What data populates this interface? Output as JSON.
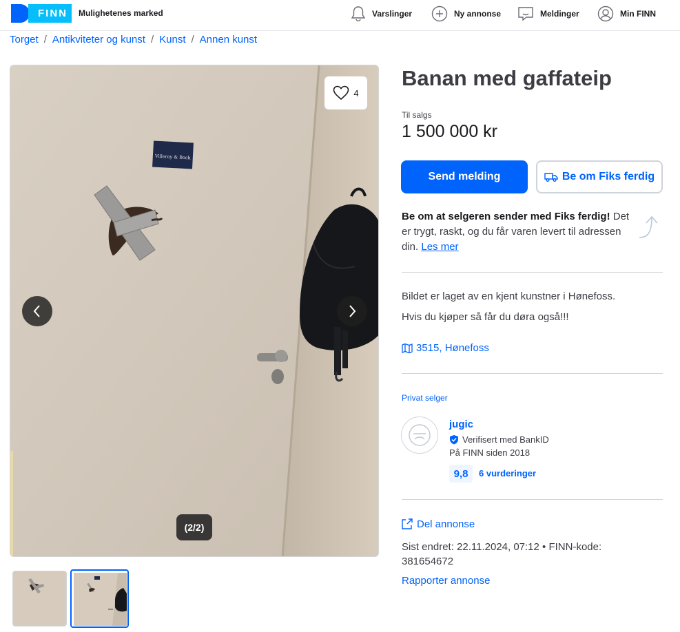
{
  "header": {
    "logo_text": "FINN",
    "slogan": "Mulighetenes marked",
    "nav": [
      {
        "label": "Varslinger",
        "icon": "bell-icon"
      },
      {
        "label": "Ny annonse",
        "icon": "plus-circle-icon"
      },
      {
        "label": "Meldinger",
        "icon": "chat-icon"
      },
      {
        "label": "Min FINN",
        "icon": "user-circle-icon"
      }
    ]
  },
  "breadcrumb": [
    "Torget",
    "Antikviteter og kunst",
    "Kunst",
    "Annen kunst"
  ],
  "gallery": {
    "favorite_count": "4",
    "counter": "(2/2)",
    "sign_text_1": "Villeroy & Boch",
    "active_thumbnail": 2
  },
  "listing": {
    "title": "Banan med gaffateip",
    "sale_label": "Til salgs",
    "price": "1 500 000 kr",
    "send_message": "Send melding",
    "fiks_button": "Be om Fiks ferdig",
    "fiks_bold": "Be om at selgeren sender med Fiks ferdig!",
    "fiks_text": " Det er trygt, raskt, og du får varen levert til adressen din. ",
    "fiks_link": "Les mer",
    "description_1": "Bildet er laget av en kjent kunstner i Hønefoss.",
    "description_2": "Hvis du kjøper så får du døra også!!!",
    "location": "3515, Hønefoss"
  },
  "seller": {
    "type": "Privat selger",
    "name": "jugic",
    "verified": "Verifisert med BankID",
    "since": "På FINN siden 2018",
    "rating": "9,8",
    "reviews": "6 vurderinger"
  },
  "footer": {
    "share": "Del annonse",
    "meta": "Sist endret: 22.11.2024, 07:12  •  FINN-kode: 381654672",
    "report": "Rapporter annonse"
  },
  "colors": {
    "primary": "#0063fb",
    "logo_light": "#06befb"
  }
}
